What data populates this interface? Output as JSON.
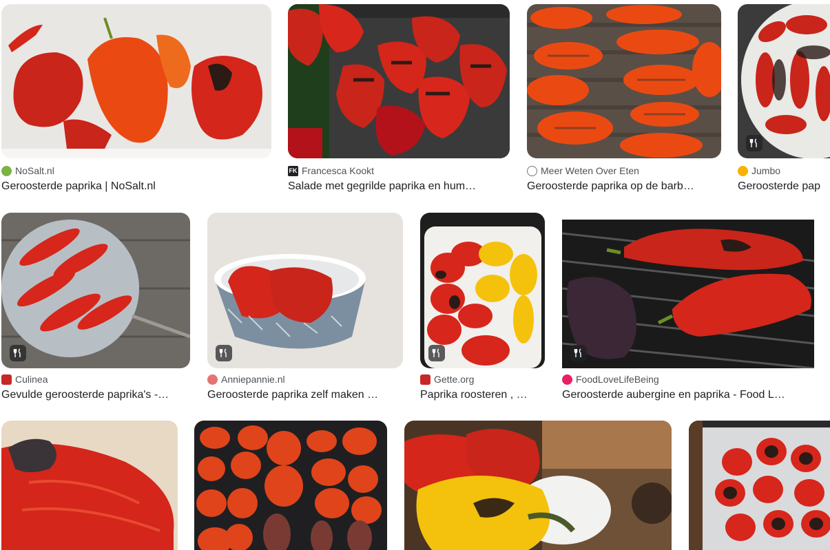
{
  "results": [
    {
      "source": "NoSalt.nl",
      "title": "Geroosterde paprika | NoSalt.nl",
      "favicon": "nosalt-favicon-icon",
      "favicon_color": "#7cb342",
      "recipe_badge": false
    },
    {
      "source": "Francesca Kookt",
      "title": "Salade met gegrilde paprika en hum…",
      "favicon": "fk-favicon-icon",
      "favicon_color": "#202124",
      "favicon_text": "FK",
      "recipe_badge": false
    },
    {
      "source": "Meer Weten Over Eten",
      "title": "Geroosterde paprika op de barb…",
      "favicon": "globe-favicon-icon",
      "favicon_color": "#70757a",
      "recipe_badge": false
    },
    {
      "source": "Jumbo",
      "title": "Geroosterde pap",
      "favicon": "jumbo-favicon-icon",
      "favicon_color": "#f9b200",
      "recipe_badge": true
    },
    {
      "source": "Culinea",
      "title": "Gevulde geroosterde paprika's -…",
      "favicon": "culinea-favicon-icon",
      "favicon_color": "#c62828",
      "recipe_badge": true
    },
    {
      "source": "Anniepannie.nl",
      "title": "Geroosterde paprika zelf maken …",
      "favicon": "anniepannie-favicon-icon",
      "favicon_color": "#e57373",
      "recipe_badge": true
    },
    {
      "source": "Gette.org",
      "title": "Paprika roosteren , …",
      "favicon": "gette-favicon-icon",
      "favicon_color": "#c62828",
      "recipe_badge": true
    },
    {
      "source": "FoodLoveLifeBeing",
      "title": "Geroosterde aubergine en paprika - Food L…",
      "favicon": "foodlove-favicon-icon",
      "favicon_color": "#e91e63",
      "recipe_badge": true
    },
    {
      "source": "",
      "title": "",
      "favicon": "",
      "recipe_badge": false
    },
    {
      "source": "",
      "title": "",
      "favicon": "",
      "recipe_badge": false
    },
    {
      "source": "",
      "title": "",
      "favicon": "",
      "recipe_badge": false
    },
    {
      "source": "",
      "title": "",
      "favicon": "",
      "recipe_badge": false
    }
  ],
  "colors": {
    "pepper_red": "#d7261b",
    "pepper_orange": "#ea4a12",
    "pepper_yellow": "#f4c20d",
    "char": "#2b1a16",
    "grill": "#3a3a3a"
  }
}
